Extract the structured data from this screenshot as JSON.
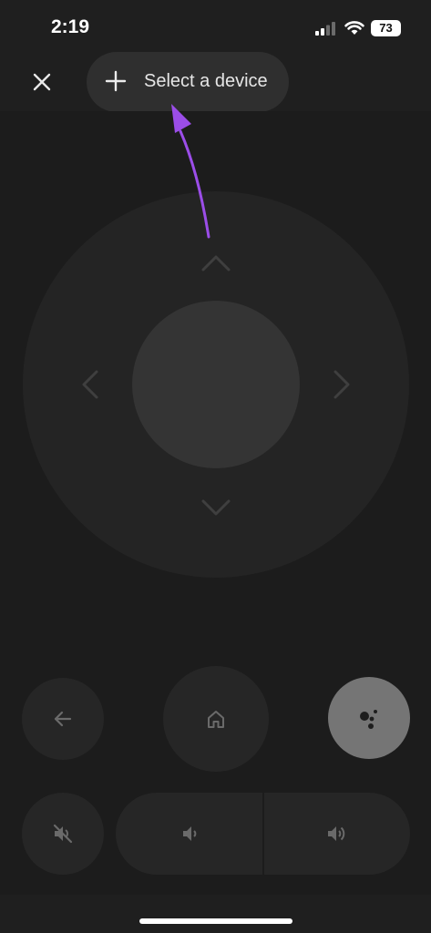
{
  "status_bar": {
    "time": "2:19",
    "battery": "73"
  },
  "header": {
    "device_button_label": "Select a device"
  },
  "icons": {
    "close": "close-icon",
    "add": "plus-icon",
    "dpad_up": "chevron-up-icon",
    "dpad_down": "chevron-down-icon",
    "dpad_left": "chevron-left-icon",
    "dpad_right": "chevron-right-icon",
    "back": "back-arrow-icon",
    "home": "home-icon",
    "assistant": "assistant-icon",
    "mute": "mute-icon",
    "volume_down": "volume-down-icon",
    "volume_up": "volume-up-icon"
  },
  "colors": {
    "background": "#1c1c1c",
    "annotation_arrow": "#9b4de8",
    "assistant_button": "#757575"
  }
}
